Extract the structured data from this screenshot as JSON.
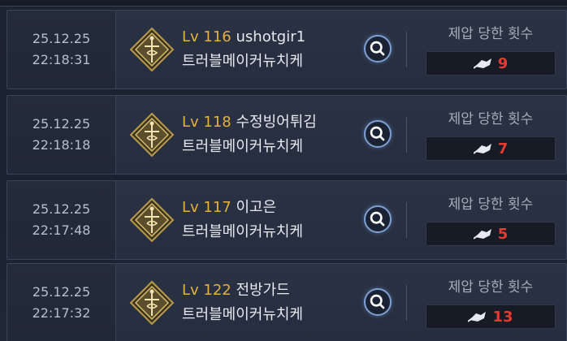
{
  "list_label": "제압 당한 횟수",
  "rows": [
    {
      "date": "25.12.25",
      "time": "22:18:31",
      "level": "Lv 116",
      "name": "ushotgir1",
      "guild": "트러블메이커뉴치케",
      "count": "9"
    },
    {
      "date": "25.12.25",
      "time": "22:18:18",
      "level": "Lv 118",
      "name": "수정빙어튀김",
      "guild": "트러블메이커뉴치케",
      "count": "7"
    },
    {
      "date": "25.12.25",
      "time": "22:17:48",
      "level": "Lv 117",
      "name": "이고은",
      "guild": "트러블메이커뉴치케",
      "count": "5"
    },
    {
      "date": "25.12.25",
      "time": "22:17:32",
      "level": "Lv 122",
      "name": "전방가드",
      "guild": "트러블메이커뉴치케",
      "count": "13"
    }
  ],
  "icons": {
    "emblem": "class-emblem-icon",
    "search": "search-icon",
    "count": "subdue-icon"
  },
  "colors": {
    "level": "#e3b23c",
    "count": "#e53b31",
    "search_ring": "#7f9fd0"
  }
}
